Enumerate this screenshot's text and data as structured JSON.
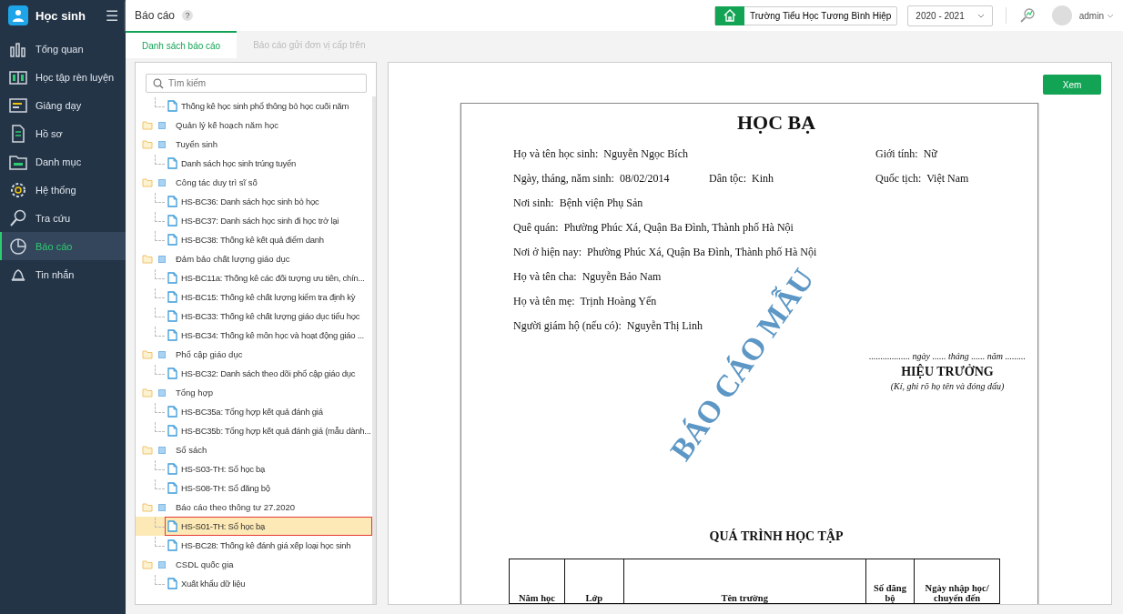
{
  "app": {
    "title": "Học sinh",
    "menu_icon": "☰"
  },
  "sidebar": {
    "items": [
      {
        "label": "Tổng quan",
        "selected": false
      },
      {
        "label": "Học tập rèn luyện",
        "selected": false
      },
      {
        "label": "Giảng dạy",
        "selected": false
      },
      {
        "label": "Hồ sơ",
        "selected": false
      },
      {
        "label": "Danh mục",
        "selected": false
      },
      {
        "label": "Hệ thống",
        "selected": false
      },
      {
        "label": "Tra cứu",
        "selected": false
      },
      {
        "label": "Báo cáo",
        "selected": true
      },
      {
        "label": "Tin nhắn",
        "selected": false
      }
    ]
  },
  "header": {
    "title": "Báo cáo",
    "help": "?",
    "school": "Trường Tiểu Học Tương Bình Hiệp",
    "year": "2020 - 2021",
    "user": "admin"
  },
  "tabs": [
    {
      "label": "Danh sách báo cáo",
      "selected": true
    },
    {
      "label": "Báo cáo gửi đơn vị cấp trên",
      "selected": false
    }
  ],
  "tree": {
    "search_placeholder": "Tìm kiếm",
    "items": [
      {
        "kind": "file",
        "label": "Thống kê học sinh phổ thông bỏ học cuối năm",
        "selected": false
      },
      {
        "kind": "folder",
        "label": "Quản lý kế hoạch năm học"
      },
      {
        "kind": "folder",
        "label": "Tuyển sinh",
        "children": [
          {
            "kind": "file",
            "label": "Danh sách học sinh trúng tuyển",
            "selected": false
          }
        ]
      },
      {
        "kind": "folder",
        "label": "Công tác duy trì sĩ số",
        "children": [
          {
            "kind": "file",
            "label": "HS-BC36: Danh sách học sinh bỏ học",
            "selected": false
          },
          {
            "kind": "file",
            "label": "HS-BC37: Danh sách học sinh đi học trở lại",
            "selected": false
          },
          {
            "kind": "file",
            "label": "HS-BC38: Thống kê kết quả điểm danh",
            "selected": false
          }
        ]
      },
      {
        "kind": "folder",
        "label": "Đảm bảo chất lượng giáo dục",
        "children": [
          {
            "kind": "file",
            "label": "HS-BC11a: Thống kê các đối tượng ưu tiên, chín...",
            "selected": false
          },
          {
            "kind": "file",
            "label": "HS-BC15: Thống kê chất lượng kiểm tra định kỳ",
            "selected": false
          },
          {
            "kind": "file",
            "label": "HS-BC33: Thống kê chất lượng giáo dục tiểu học",
            "selected": false
          },
          {
            "kind": "file",
            "label": "HS-BC34: Thống kê môn học và hoạt động giáo ...",
            "selected": false
          }
        ]
      },
      {
        "kind": "folder",
        "label": "Phổ cập giáo dục",
        "children": [
          {
            "kind": "file",
            "label": "HS-BC32: Danh sách theo dõi phổ cập giáo dục",
            "selected": false
          }
        ]
      },
      {
        "kind": "folder",
        "label": "Tổng hợp",
        "children": [
          {
            "kind": "file",
            "label": "HS-BC35a: Tổng hợp kết quả đánh giá",
            "selected": false
          },
          {
            "kind": "file",
            "label": "HS-BC35b: Tổng hợp kết quả đánh giá (mẫu dành...",
            "selected": false
          }
        ]
      },
      {
        "kind": "folder",
        "label": "Sổ sách",
        "children": [
          {
            "kind": "file",
            "label": "HS-S03-TH: Sổ học bạ",
            "selected": false
          },
          {
            "kind": "file",
            "label": "HS-S08-TH: Sổ đăng bộ",
            "selected": false
          }
        ]
      },
      {
        "kind": "folder",
        "label": "Báo cáo theo thông tư 27.2020",
        "children": [
          {
            "kind": "file",
            "label": "HS-S01-TH: Sổ học bạ",
            "selected": true
          },
          {
            "kind": "file",
            "label": "HS-BC28: Thống kê đánh giá xếp loại học sinh",
            "selected": false
          }
        ]
      },
      {
        "kind": "folder",
        "label": "CSDL quốc gia",
        "children": [
          {
            "kind": "file",
            "label": "Xuất khẩu dữ liệu",
            "selected": false
          }
        ]
      }
    ]
  },
  "preview": {
    "view_button": "Xem",
    "document": {
      "title": "HỌC BẠ",
      "stamp": "BÁO CÁO MẪU",
      "rows": [
        [
          {
            "label": "Họ và tên học sinh:",
            "value": "Nguyễn Ngọc Bích"
          },
          null,
          {
            "label": "Giới tính:",
            "value": "Nữ"
          }
        ],
        [
          {
            "label": "Ngày, tháng, năm sinh:",
            "value": "08/02/2014"
          },
          {
            "label": "Dân tộc:",
            "value": "Kinh"
          },
          {
            "label": "Quốc tịch:",
            "value": "Việt Nam"
          }
        ],
        [
          {
            "label": "Nơi sinh:",
            "value": "Bệnh viện Phụ Sản"
          }
        ],
        [
          {
            "label": "Quê quán:",
            "value": "Phường Phúc Xá, Quận Ba Đình, Thành phố Hà Nội"
          }
        ],
        [
          {
            "label": "Nơi ở hiện nay:",
            "value": "Phường Phúc Xá, Quận Ba Đình, Thành phố Hà Nội"
          }
        ],
        [
          {
            "label": "Họ và tên cha:",
            "value": "Nguyễn Bảo Nam"
          }
        ],
        [
          {
            "label": "Họ và tên mẹ:",
            "value": "Trịnh Hoàng Yến"
          }
        ],
        [
          {
            "label": "Người giám hộ (nếu có):",
            "value": "Nguyễn Thị Linh"
          }
        ]
      ],
      "date_line": ".................. ngày ...... tháng ...... năm .........",
      "signer": "HIỆU TRƯỞNG",
      "sign_note": "(Kí, ghi rõ họ tên và đóng dấu)",
      "section_title": "QUÁ TRÌNH HỌC TẬP",
      "table_columns": [
        "Năm học",
        "Lớp",
        "Tên trường",
        "Số đăng bộ",
        "Ngày nhập học/ chuyển đến"
      ]
    }
  }
}
